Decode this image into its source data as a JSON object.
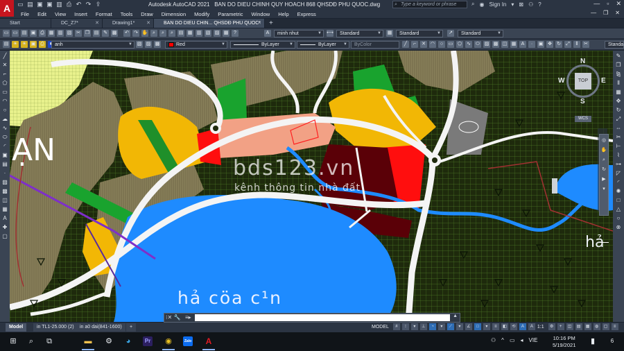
{
  "titlebar": {
    "app_name": "Autodesk AutoCAD 2021",
    "doc_name": "BAN DO DIEU CHINH QUY HOACH 868 QHSDĐ PHU QUOC.dwg",
    "search_placeholder": "Type a keyword or phrase",
    "sign_in": "Sign In",
    "logo_letter": "A"
  },
  "menu": [
    "File",
    "Edit",
    "View",
    "Insert",
    "Format",
    "Tools",
    "Draw",
    "Dimension",
    "Modify",
    "Parametric",
    "Window",
    "Help",
    "Express"
  ],
  "tabs": [
    {
      "label": "Start"
    },
    {
      "label": "DC_Z7*"
    },
    {
      "label": "Drawing1*"
    },
    {
      "label": "BAN DO DIEU CHIN... QHSDĐ PHU QUOC*"
    }
  ],
  "toolbar1": {
    "text_style": "minh nhut",
    "dim_style": "Standard",
    "table_style": "Standard",
    "mleader_style": "Standard"
  },
  "toolbar2": {
    "layer": "anh",
    "color": "Red",
    "color_hex": "#ff0000",
    "linetype": "ByLayer",
    "lineweight": "ByLayer",
    "plotstyle": "ByColor",
    "visual_style": "Standar"
  },
  "drawing": {
    "label_an": "ẠN",
    "label_ha": "hả",
    "label_cua": "hả cöa c¹n",
    "watermark_main": "bds123.vn",
    "watermark_sub": "kênh thông tin nhà đất",
    "viewcube": {
      "top": "TOP",
      "n": "N",
      "s": "S",
      "e": "E",
      "w": "W",
      "wcs": "WCS"
    }
  },
  "command": {
    "prompt": "≡▸",
    "value": "",
    "placeholder": ""
  },
  "layout_tabs": [
    "Model",
    "in TL1-25.000 (2)",
    "in a0 dai(841-1600)"
  ],
  "status": {
    "mode": "MODEL",
    "scale": "1:1"
  },
  "taskbar": {
    "time": "10:16 PM",
    "date": "5/19/2021",
    "lang": "VIE",
    "notif_count": "6"
  }
}
